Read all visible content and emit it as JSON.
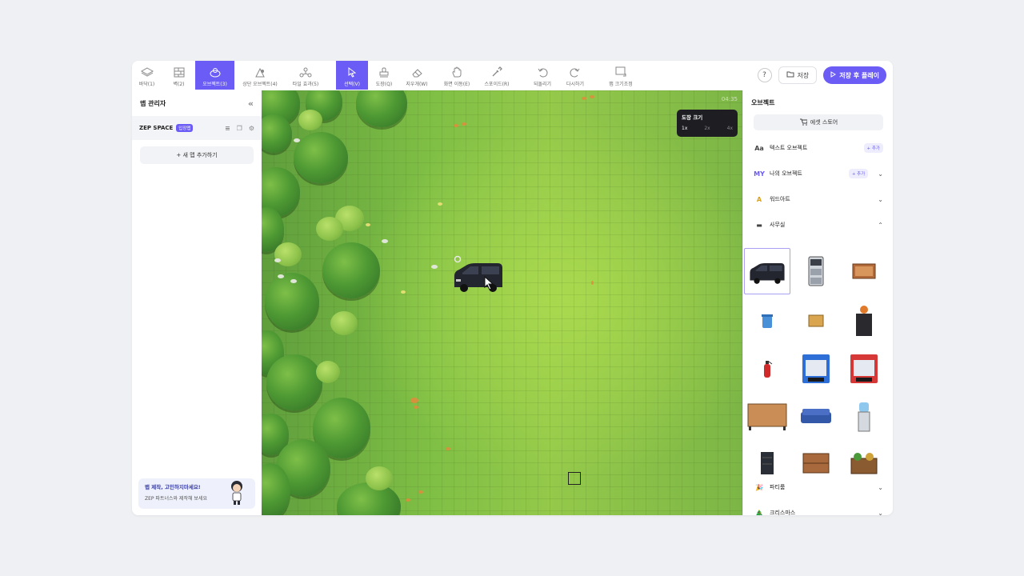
{
  "toolbar": {
    "tools": [
      {
        "label": "바닥(1)",
        "icon": "floor-icon"
      },
      {
        "label": "벽(2)",
        "icon": "wall-icon"
      },
      {
        "label": "오브젝트(3)",
        "icon": "object-icon",
        "active": true
      },
      {
        "label": "상단 오브젝트(4)",
        "icon": "top-object-icon"
      },
      {
        "label": "타일 효과(5)",
        "icon": "tile-effect-icon"
      },
      {
        "label": "선택(V)",
        "icon": "select-icon",
        "active": true
      },
      {
        "label": "도장(Q)",
        "icon": "stamp-icon"
      },
      {
        "label": "지우개(W)",
        "icon": "eraser-icon"
      },
      {
        "label": "화면 이동(E)",
        "icon": "hand-icon"
      },
      {
        "label": "스포이드(R)",
        "icon": "eyedropper-icon"
      },
      {
        "label": "되돌리기",
        "icon": "undo-icon"
      },
      {
        "label": "다시하기",
        "icon": "redo-icon"
      },
      {
        "label": "맵 크기조정",
        "icon": "resize-icon"
      }
    ],
    "help_label": "?",
    "save_label": "저장",
    "save_play_label": "저장 후 플레이"
  },
  "left_panel": {
    "title": "맵 관리자",
    "space_name": "ZEP SPACE",
    "space_badge": "입장맵",
    "add_map_label": "+ 새 맵 추가하기",
    "promo_title": "맵 제작, 고민하지마세요!",
    "promo_subtitle": "ZEP 파트너스와 제작해 보세요"
  },
  "map": {
    "zoom_title": "도장 크기",
    "zoom_options": [
      "1x",
      "2x",
      "4x"
    ],
    "zoom_selected": "1x",
    "timer": "04:35"
  },
  "right_panel": {
    "title": "오브젝트",
    "store_label": "에셋 스토어",
    "categories": [
      {
        "icon_text": "Aa",
        "label": "텍스트 오브젝트",
        "add": "+ 추가"
      },
      {
        "icon_text": "MY",
        "label": "나의 오브젝트",
        "add": "+ 추가"
      },
      {
        "icon_text": "A",
        "label": "워드아트"
      },
      {
        "icon_text": "▬",
        "label": "사무실"
      }
    ],
    "bottom_categories": [
      {
        "label": "파티룸"
      },
      {
        "label": "크리스마스"
      }
    ]
  },
  "colors": {
    "accent": "#6b5cf6",
    "toolbar_bg": "#ffffff",
    "panel_bg": "#f3f4f8"
  }
}
